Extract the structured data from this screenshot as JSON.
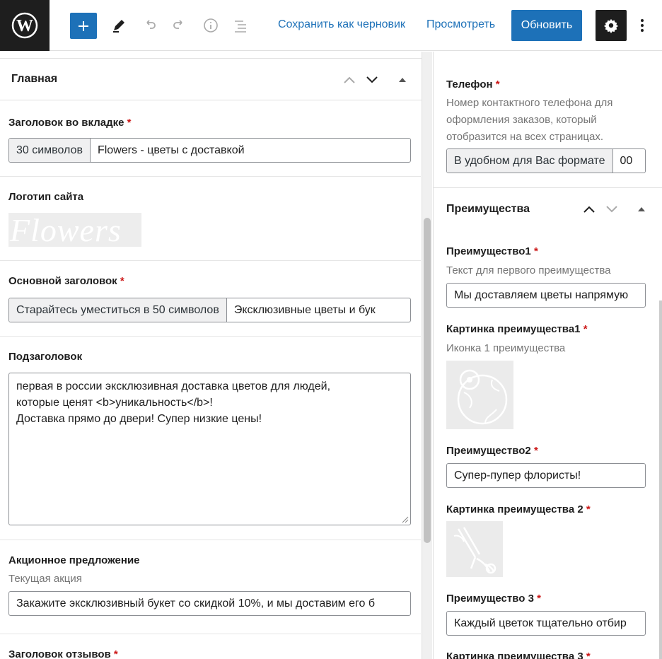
{
  "toolbar": {
    "save_draft": "Сохранить как черновик",
    "preview": "Просмотреть",
    "update": "Обновить",
    "accent": "#1d71b8"
  },
  "main_panel": {
    "title": "Главная",
    "tab_title": {
      "label": "Заголовок во вкладке",
      "prefix": "30 символов",
      "value": "Flowers - цветы с доставкой"
    },
    "logo": {
      "label": "Логотип сайта",
      "image_text": "Flowers"
    },
    "main_heading": {
      "label": "Основной заголовок",
      "prefix": "Старайтесь уместиться в 50 символов",
      "value": "Эксклюзивные цветы и бук"
    },
    "subheading": {
      "label": "Подзаголовок",
      "lines": [
        "первая в россии эксклюзивная доставка цветов для людей,",
        "которые ценят <b>уникальность</b>!",
        "Доставка прямо до двери! Супер низкие цены!"
      ]
    },
    "promo": {
      "label": "Акционное предложение",
      "description": "Текущая акция",
      "value": "Закажите эксклюзивный букет со скидкой 10%, и мы доставим его б"
    },
    "reviews_title": {
      "label": "Заголовок отзывов"
    }
  },
  "side_panel": {
    "phone": {
      "label": "Телефон",
      "description_lines": [
        "Номер контактного телефона для",
        "оформления заказов, который",
        "отобразится на всех страницах."
      ],
      "prefix": "В удобном для Вас формате",
      "value": "00"
    },
    "advantages": {
      "title": "Преимущества",
      "adv1": {
        "label": "Преимущество1",
        "description": "Текст для первого преимущества",
        "value": "Мы доставляем цветы напрямую"
      },
      "img1": {
        "label": "Картинка преимущества1",
        "description": "Иконка 1 преимущества",
        "icon": "globe-pin-icon"
      },
      "adv2": {
        "label": "Преимущество2",
        "value": "Супер-пупер флористы!"
      },
      "img2": {
        "label": "Картинка преимущества 2",
        "icon": "flowers-icon"
      },
      "adv3": {
        "label": "Преимущество 3",
        "value": "Каждый цветок тщательно отбир"
      },
      "img3": {
        "label": "Картинка преимущества 3"
      }
    }
  },
  "required_mark": "*"
}
